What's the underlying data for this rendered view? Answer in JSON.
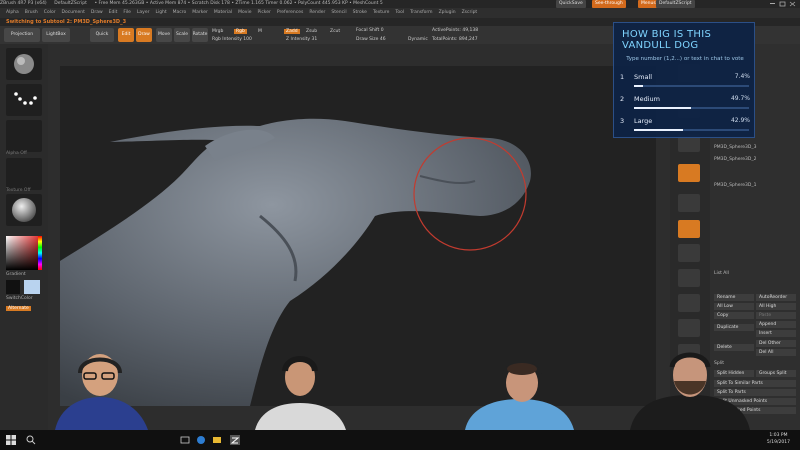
{
  "titlebar": {
    "app": "ZBrush 4R7 P3 (x64)",
    "doc": "DefaultZScript",
    "stats": "• Free Mem 45.263GB • Active Mem 874 • Scratch Disk 178 • ZTime 1.165 Timer 0.062 • PolyCount 445.953 KP • MeshCount 5",
    "quicksave": "QuickSave",
    "see_through": "See-through",
    "menus_btn": "Menus",
    "default_zscript": "DefaultZScript"
  },
  "menubar": {
    "items": [
      "Alpha",
      "Brush",
      "Color",
      "Document",
      "Draw",
      "Edit",
      "File",
      "Layer",
      "Light",
      "Macro",
      "Marker",
      "Material",
      "Movie",
      "Picker",
      "Preferences",
      "Render",
      "Stencil",
      "Stroke",
      "Texture",
      "Tool",
      "Transform",
      "Zplugin",
      "Zscript"
    ]
  },
  "infobar": {
    "text": "Switching to Subtool 2: PM3D_Sphere3D_3"
  },
  "toolbar": {
    "projection_master": "Projection Master",
    "lightbox": "LightBox",
    "quick_sketch": "Quick Sketch",
    "edit": "Edit",
    "draw": "Draw",
    "move": "Move",
    "scale": "Scale",
    "rotate": "Rotate",
    "mrgb": "Mrgb",
    "rgb": "Rgb",
    "m": "M",
    "zadd": "Zadd",
    "zsub": "Zsub",
    "zcut": "Zcut",
    "rgb_intensity": "Rgb Intensity 100",
    "z_intensity": "Z Intensity 31",
    "focal_shift": "Focal Shift 0",
    "draw_size": "Draw Size 46",
    "dynamic": "Dynamic",
    "active_points": "ActivePoints: 49,138",
    "total_points": "TotalPoints: 894,247"
  },
  "leftpanel": {
    "gradient": "Gradient",
    "switch_color": "SwitchColor",
    "alternate": "Alternate",
    "alpha_off": "Alpha Off",
    "texture_off": "Texture Off"
  },
  "poll": {
    "title": "HOW BIG IS THIS VANDULL DOG",
    "subtitle": "Type number (1,2...) or text in chat to vote",
    "options": [
      {
        "num": "1",
        "label": "Small",
        "pct": "7.4%",
        "value": 7.4
      },
      {
        "num": "2",
        "label": "Medium",
        "pct": "49.7%",
        "value": 49.7
      },
      {
        "num": "3",
        "label": "Large",
        "pct": "42.9%",
        "value": 42.9
      }
    ]
  },
  "rightpanel": {
    "subtools": [
      "PM3D_Sphere3D_3",
      "PM3D_Sphere3D_2",
      "PM3D_Sphere3D_1"
    ],
    "list_all": "List All",
    "rename": "Rename",
    "autoreorder": "AutoReorder",
    "all_low": "All Low",
    "all_high": "All High",
    "copy": "Copy",
    "paste": "Paste",
    "duplicate": "Duplicate",
    "append": "Append",
    "insert": "Insert",
    "delete": "Delete",
    "del_other": "Del Other",
    "del_all": "Del All",
    "split": "Split",
    "split_hidden": "Split Hidden",
    "groups_split": "Groups Split",
    "split_similar": "Split To Similar Parts",
    "split_parts": "Split To Parts",
    "split_unmasked": "Split Unmasked Points",
    "split_masked": "Split Masked Points"
  },
  "taskbar": {
    "time": "1:03 PM",
    "date": "5/19/2017"
  }
}
